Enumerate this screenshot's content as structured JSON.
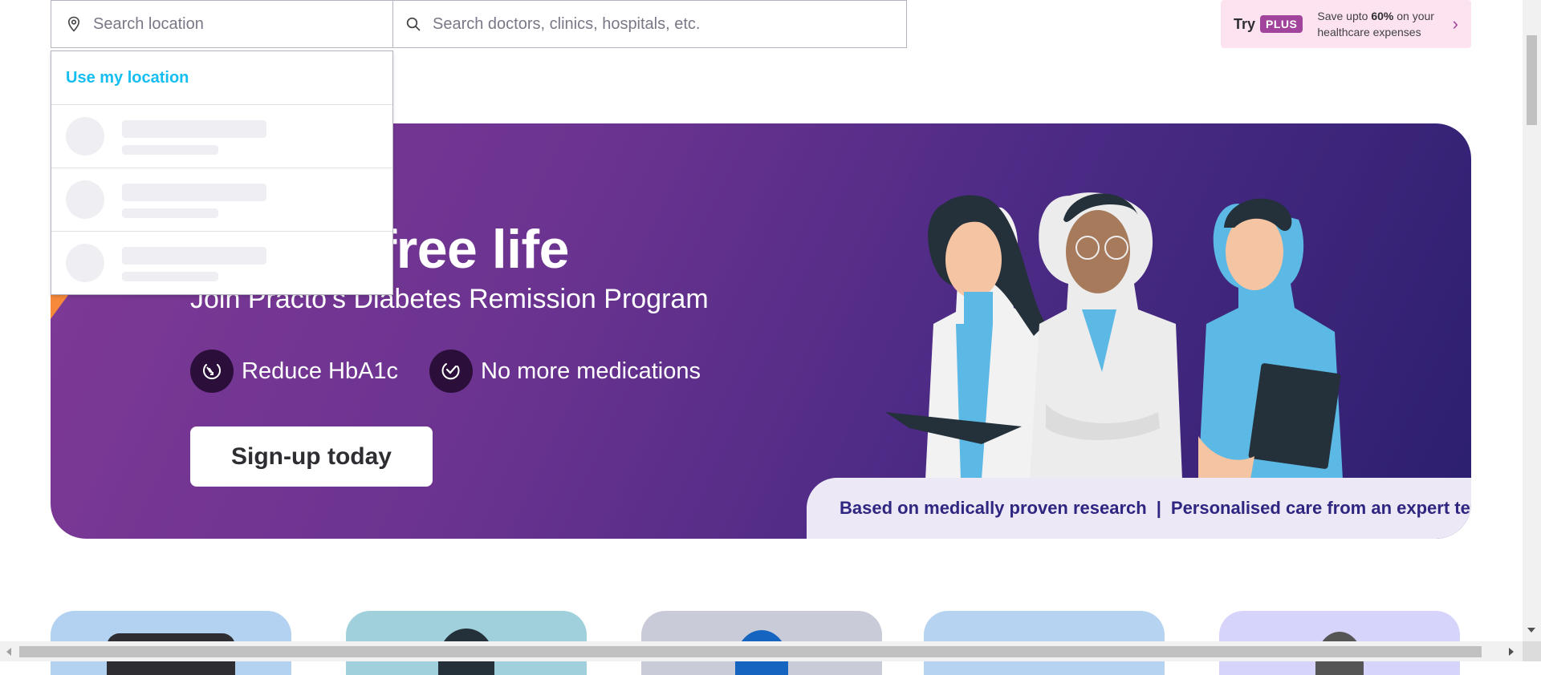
{
  "search": {
    "location_placeholder": "Search location",
    "query_placeholder": "Search doctors, clinics, hospitals, etc.",
    "location_icon": "map-pin-icon",
    "query_icon": "search-icon"
  },
  "plus_promo": {
    "try_label": "Try",
    "badge": "PLUS",
    "text_prefix": "Save upto ",
    "text_highlight": "60%",
    "text_suffix": " on your healthcare expenses",
    "icon": "chevron-right-icon",
    "color": "#a2449b"
  },
  "location_dropdown": {
    "use_my_location": "Use my location",
    "loading_rows": 3
  },
  "hero": {
    "title": "abetes-free life",
    "subtitle": "Join Practo’s Diabetes Remission Program",
    "features": [
      {
        "label": "Reduce HbA1c",
        "icon": "reduce-hba1c-icon"
      },
      {
        "label": "No more medications",
        "icon": "no-medication-icon"
      }
    ],
    "cta": "Sign-up today",
    "footer_left": "Based on medically proven research",
    "footer_sep": "|",
    "footer_right": "Personalised care from an expert team"
  },
  "cards": [
    {
      "color": "#b3d1f0"
    },
    {
      "color": "#9fd0dc"
    },
    {
      "color": "#c9ccd8"
    },
    {
      "color": "#b6d3f1"
    },
    {
      "color": "#d6d4fb"
    }
  ]
}
